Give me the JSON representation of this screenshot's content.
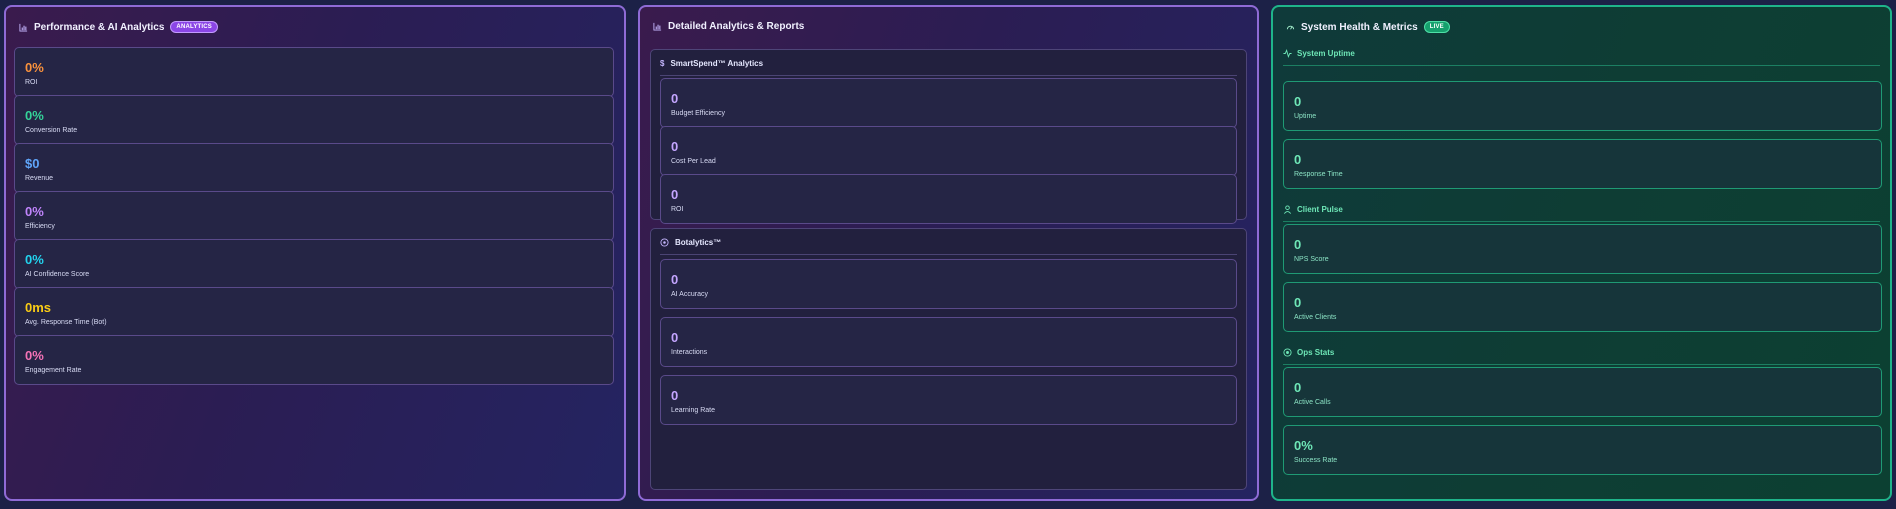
{
  "panels": {
    "performance": {
      "title": "Performance & AI Analytics",
      "badge": "ANALYTICS",
      "metrics": [
        {
          "value": "0%",
          "label": "ROI",
          "color": "#fb923c"
        },
        {
          "value": "0%",
          "label": "Conversion Rate",
          "color": "#34d399"
        },
        {
          "value": "$0",
          "label": "Revenue",
          "color": "#60a5fa"
        },
        {
          "value": "0%",
          "label": "Efficiency",
          "color": "#c084fc"
        },
        {
          "value": "0%",
          "label": "AI Confidence Score",
          "color": "#22d3ee"
        },
        {
          "value": "0ms",
          "label": "Avg. Response Time (Bot)",
          "color": "#facc15"
        },
        {
          "value": "0%",
          "label": "Engagement Rate",
          "color": "#f472b6"
        }
      ]
    },
    "reports": {
      "title": "Detailed Analytics & Reports",
      "smartspend": {
        "title": "SmartSpend™ Analytics",
        "icon": "dollar-icon",
        "metrics": [
          {
            "value": "0",
            "label": "Budget Efficiency"
          },
          {
            "value": "0",
            "label": "Cost Per Lead"
          },
          {
            "value": "0",
            "label": "ROI"
          }
        ]
      },
      "botalytics": {
        "title": "Botalytics™",
        "icon": "bot-circle-icon",
        "metrics": [
          {
            "value": "0",
            "label": "AI Accuracy"
          },
          {
            "value": "0",
            "label": "Interactions"
          },
          {
            "value": "0",
            "label": "Learning Rate"
          }
        ]
      },
      "value_color": "#c4a5ff"
    },
    "health": {
      "title": "System Health & Metrics",
      "badge": "LIVE",
      "uptime": {
        "title": "System Uptime",
        "metrics": [
          {
            "value": "0",
            "label": "Uptime"
          },
          {
            "value": "0",
            "label": "Response Time"
          }
        ]
      },
      "client": {
        "title": "Client Pulse",
        "metrics": [
          {
            "value": "0",
            "label": "NPS Score"
          },
          {
            "value": "0",
            "label": "Active Clients"
          }
        ]
      },
      "ops": {
        "title": "Ops Stats",
        "metrics": [
          {
            "value": "0",
            "label": "Active Calls"
          },
          {
            "value": "0%",
            "label": "Success Rate"
          }
        ]
      },
      "value_color": "#6ee7b7"
    }
  },
  "colors": {
    "accent_purple": "#8f6bd6",
    "accent_green": "#1fb48a"
  }
}
